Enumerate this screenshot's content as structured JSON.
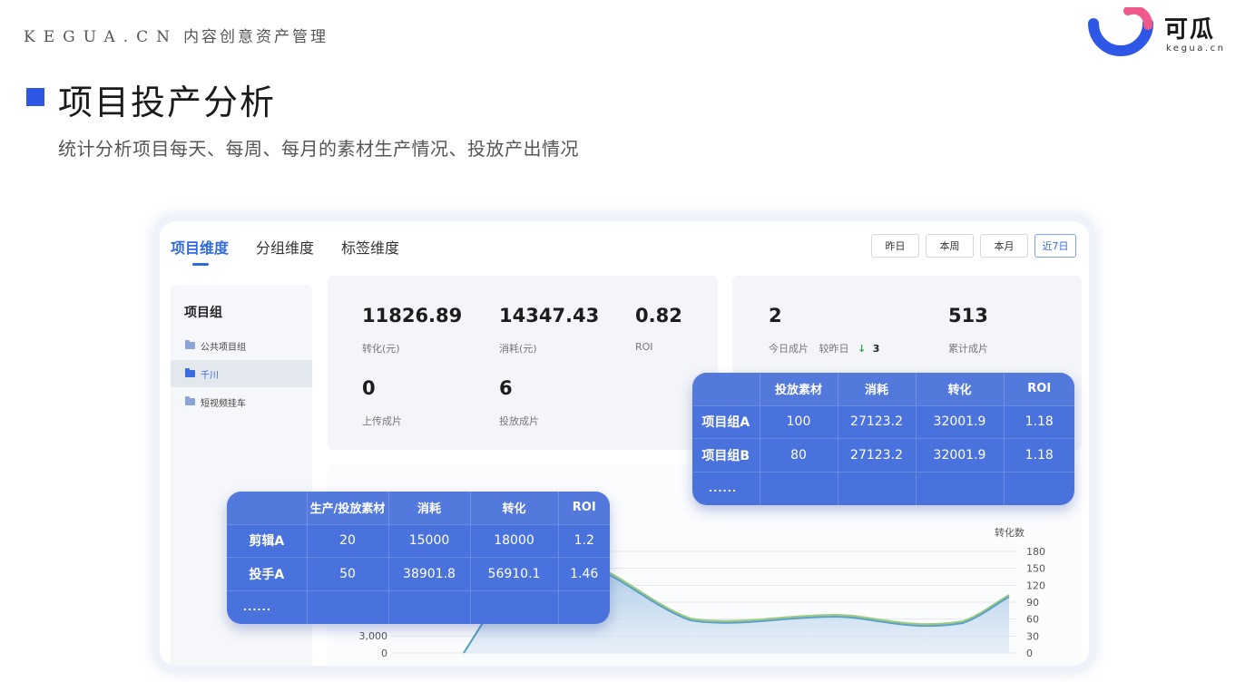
{
  "header": {
    "brand": "KEGUA.CN",
    "brand_sub": "内容创意资产管理",
    "logo_text": "可瓜",
    "logo_domain": "kegua.cn"
  },
  "section": {
    "title": "项目投产分析",
    "description": "统计分析项目每天、每周、每月的素材生产情况、投放产出情况"
  },
  "tabs": [
    {
      "label": "项目维度",
      "active": true
    },
    {
      "label": "分组维度",
      "active": false
    },
    {
      "label": "标签维度",
      "active": false
    }
  ],
  "range_buttons": [
    {
      "label": "昨日",
      "active": false
    },
    {
      "label": "本周",
      "active": false
    },
    {
      "label": "本月",
      "active": false
    },
    {
      "label": "近7日",
      "active": true
    }
  ],
  "sidebar": {
    "title": "项目组",
    "items": [
      {
        "label": "公共项目组",
        "active": false
      },
      {
        "label": "千川",
        "active": true
      },
      {
        "label": "短视频挂车",
        "active": false
      }
    ]
  },
  "stats_a": [
    {
      "value": "11826.89",
      "label": "转化(元)"
    },
    {
      "value": "14347.43",
      "label": "消耗(元)"
    },
    {
      "value": "0.82",
      "label": "ROI"
    },
    {
      "value": "0",
      "label": "上传成片"
    },
    {
      "value": "6",
      "label": "投放成片"
    }
  ],
  "stats_b": {
    "today": {
      "value": "2",
      "label": "今日成片",
      "compare_label": "较昨日",
      "compare_arrow": "↓",
      "compare_value": "3"
    },
    "total": {
      "value": "513",
      "label": "累计成片"
    }
  },
  "table_right": {
    "headers": [
      "",
      "投放素材",
      "消耗",
      "转化",
      "ROI"
    ],
    "rows": [
      [
        "项目组A",
        "100",
        "27123.2",
        "32001.9",
        "1.18"
      ],
      [
        "项目组B",
        "80",
        "27123.2",
        "32001.9",
        "1.18"
      ]
    ],
    "more": "......"
  },
  "table_left": {
    "headers": [
      "",
      "生产/投放素材",
      "消耗",
      "转化",
      "ROI"
    ],
    "rows": [
      [
        "剪辑A",
        "20",
        "15000",
        "18000",
        "1.2"
      ],
      [
        "投手A",
        "50",
        "38901.8",
        "56910.1",
        "1.46"
      ]
    ],
    "more": "......"
  },
  "chart_data": {
    "type": "area",
    "ylabel_right": "转化数",
    "right_axis_ticks": [
      "180",
      "150",
      "120",
      "90",
      "60",
      "30",
      "0"
    ],
    "left_axis_ticks": [
      "3,000",
      "0"
    ],
    "colors": {
      "fill": "#bcd4ea",
      "line": "#5aa0c8",
      "line2": "#9ecb7c"
    }
  },
  "colors": {
    "accent": "#2f57e6",
    "table_bg": "#4a72dc",
    "tab_active": "#2f6bdf"
  }
}
